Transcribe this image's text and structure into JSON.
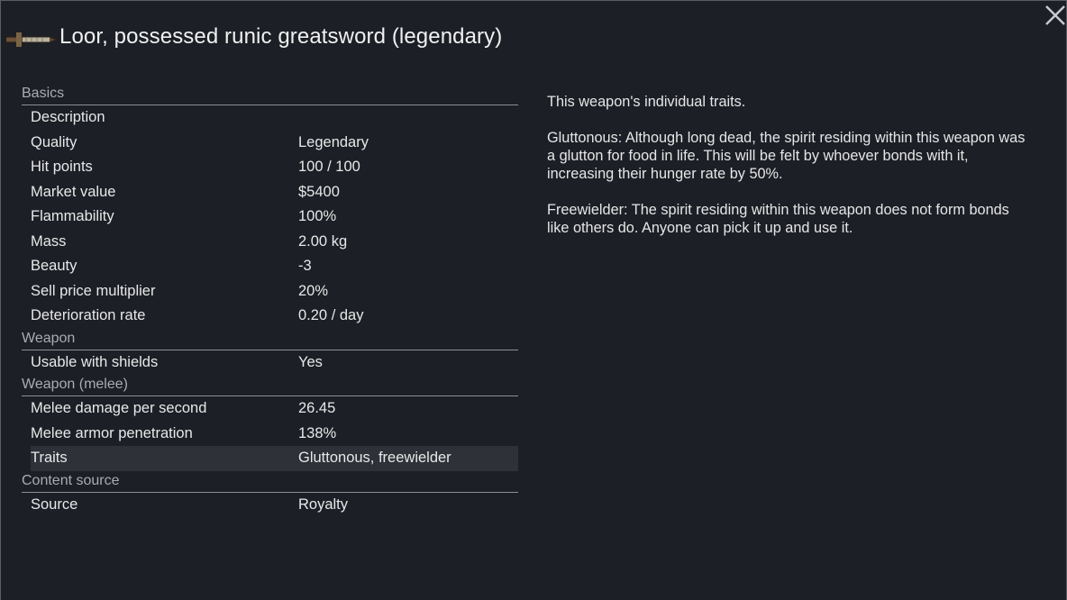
{
  "window": {
    "title": "Loor, possessed runic greatsword (legendary)",
    "item_icon": "greatsword-icon",
    "close_icon": "close-icon"
  },
  "sections": {
    "basics": {
      "header": "Basics",
      "rows": [
        {
          "label": "Description",
          "value": ""
        },
        {
          "label": "Quality",
          "value": "Legendary"
        },
        {
          "label": "Hit points",
          "value": "100 / 100"
        },
        {
          "label": "Market value",
          "value": "$5400"
        },
        {
          "label": "Flammability",
          "value": "100%"
        },
        {
          "label": "Mass",
          "value": "2.00 kg"
        },
        {
          "label": "Beauty",
          "value": "-3"
        },
        {
          "label": "Sell price multiplier",
          "value": "20%"
        },
        {
          "label": "Deterioration rate",
          "value": "0.20 / day"
        }
      ]
    },
    "weapon": {
      "header": "Weapon",
      "rows": [
        {
          "label": "Usable with shields",
          "value": "Yes"
        }
      ]
    },
    "melee": {
      "header": "Weapon (melee)",
      "rows": [
        {
          "label": "Melee damage per second",
          "value": "26.45"
        },
        {
          "label": "Melee armor penetration",
          "value": "138%"
        },
        {
          "label": "Traits",
          "value": "Gluttonous, freewielder"
        }
      ]
    },
    "content": {
      "header": "Content source",
      "rows": [
        {
          "label": "Source",
          "value": "Royalty"
        }
      ]
    }
  },
  "description": {
    "intro": "This weapon's individual traits.",
    "trait1": "Gluttonous: Although long dead, the spirit residing within this weapon was a glutton for food in life. This will be felt by whoever bonds with it, increasing their hunger rate by 50%.",
    "trait2": "Freewielder: The spirit residing within this weapon does not form bonds like others do. Anyone can pick it up and use it."
  },
  "colors": {
    "background": "#1c1f26",
    "highlight_row": "#2e3138",
    "header_text": "#a9acb1"
  }
}
